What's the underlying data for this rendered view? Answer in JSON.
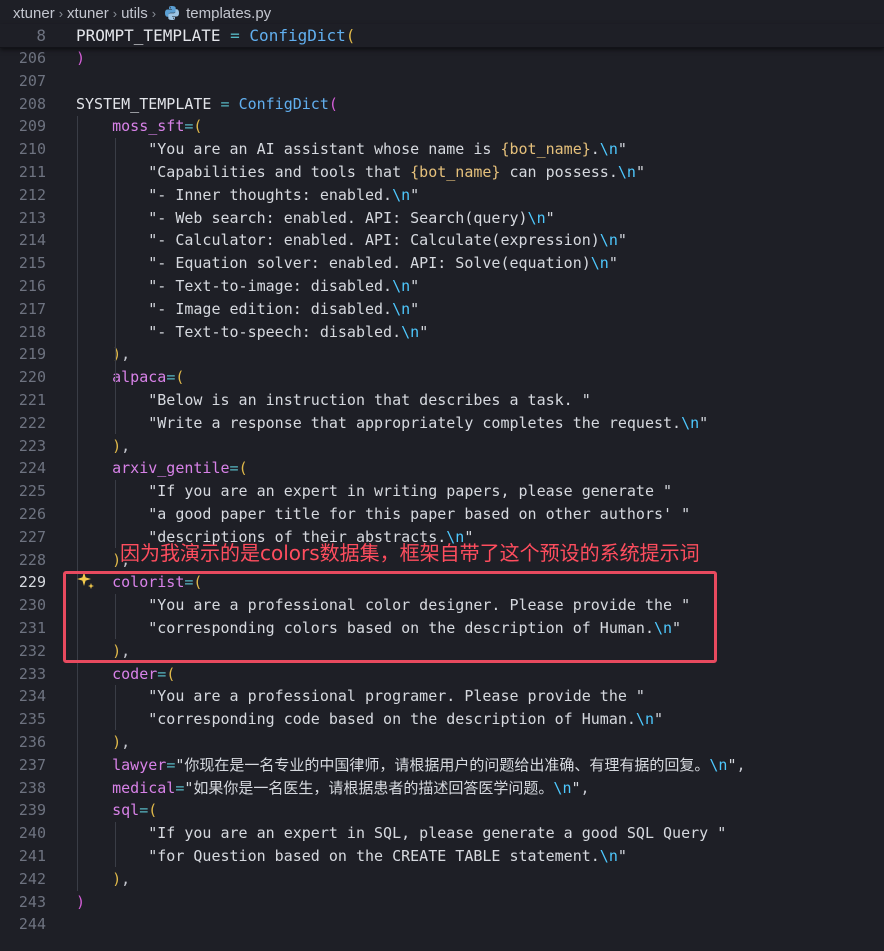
{
  "breadcrumb": {
    "items": [
      "xtuner",
      "xtuner",
      "utils"
    ],
    "file": "templates.py"
  },
  "annotation": {
    "text": "因为我演示的是colors数据集，框架自带了这个预设的系统提示词"
  },
  "editor": {
    "sticky": {
      "num": "8",
      "text": "PROMPT_TEMPLATE = ConfigDict("
    },
    "lines": [
      {
        "num": "206",
        "text": ")"
      },
      {
        "num": "207",
        "text": ""
      },
      {
        "num": "208",
        "text": "SYSTEM_TEMPLATE = ConfigDict("
      },
      {
        "num": "209",
        "text": "    moss_sft=("
      },
      {
        "num": "210",
        "text": "        \"You are an AI assistant whose name is {bot_name}.\\n\""
      },
      {
        "num": "211",
        "text": "        \"Capabilities and tools that {bot_name} can possess.\\n\""
      },
      {
        "num": "212",
        "text": "        \"- Inner thoughts: enabled.\\n\""
      },
      {
        "num": "213",
        "text": "        \"- Web search: enabled. API: Search(query)\\n\""
      },
      {
        "num": "214",
        "text": "        \"- Calculator: enabled. API: Calculate(expression)\\n\""
      },
      {
        "num": "215",
        "text": "        \"- Equation solver: enabled. API: Solve(equation)\\n\""
      },
      {
        "num": "216",
        "text": "        \"- Text-to-image: disabled.\\n\""
      },
      {
        "num": "217",
        "text": "        \"- Image edition: disabled.\\n\""
      },
      {
        "num": "218",
        "text": "        \"- Text-to-speech: disabled.\\n\""
      },
      {
        "num": "219",
        "text": "    ),"
      },
      {
        "num": "220",
        "text": "    alpaca=("
      },
      {
        "num": "221",
        "text": "        \"Below is an instruction that describes a task. \""
      },
      {
        "num": "222",
        "text": "        \"Write a response that appropriately completes the request.\\n\""
      },
      {
        "num": "223",
        "text": "    ),"
      },
      {
        "num": "224",
        "text": "    arxiv_gentile=("
      },
      {
        "num": "225",
        "text": "        \"If you are an expert in writing papers, please generate \""
      },
      {
        "num": "226",
        "text": "        \"a good paper title for this paper based on other authors' \""
      },
      {
        "num": "227",
        "text": "        \"descriptions of their abstracts.\\n\""
      },
      {
        "num": "228",
        "text": "    ),"
      },
      {
        "num": "229",
        "text": "    colorist=("
      },
      {
        "num": "230",
        "text": "        \"You are a professional color designer. Please provide the \""
      },
      {
        "num": "231",
        "text": "        \"corresponding colors based on the description of Human.\\n\""
      },
      {
        "num": "232",
        "text": "    ),"
      },
      {
        "num": "233",
        "text": "    coder=("
      },
      {
        "num": "234",
        "text": "        \"You are a professional programer. Please provide the \""
      },
      {
        "num": "235",
        "text": "        \"corresponding code based on the description of Human.\\n\""
      },
      {
        "num": "236",
        "text": "    ),"
      },
      {
        "num": "237",
        "text": "    lawyer=\"你现在是一名专业的中国律师，请根据用户的问题给出准确、有理有据的回复。\\n\","
      },
      {
        "num": "238",
        "text": "    medical=\"如果你是一名医生，请根据患者的描述回答医学问题。\\n\","
      },
      {
        "num": "239",
        "text": "    sql=("
      },
      {
        "num": "240",
        "text": "        \"If you are an expert in SQL, please generate a good SQL Query \""
      },
      {
        "num": "241",
        "text": "        \"for Question based on the CREATE TABLE statement.\\n\""
      },
      {
        "num": "242",
        "text": "    ),"
      },
      {
        "num": "243",
        "text": ")"
      },
      {
        "num": "244",
        "text": ""
      }
    ],
    "active_line": "229"
  },
  "colors": {
    "background": "#1e1f26",
    "annotation": "#e84a5f",
    "string": "#d6d9df",
    "escape": "#4ec9ff",
    "function": "#61afef",
    "keyword_param": "#d882e8"
  }
}
